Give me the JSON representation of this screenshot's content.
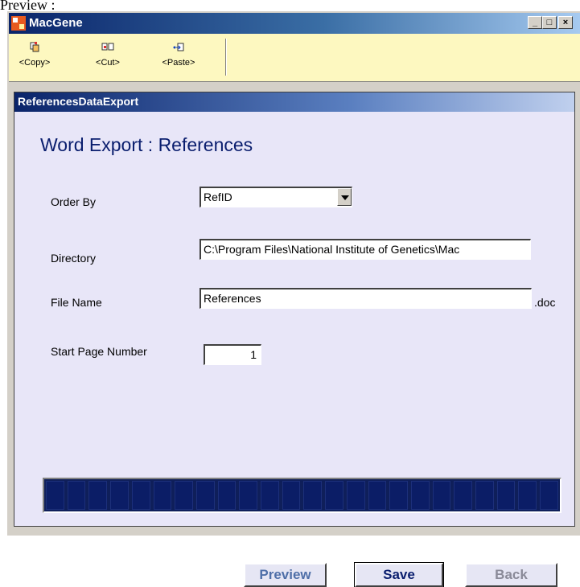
{
  "caption": "Preview :",
  "window": {
    "title": "MacGene",
    "controls": {
      "minimize": "_",
      "maximize": "□",
      "close": "×"
    }
  },
  "toolbar": {
    "copy_label": "<Copy>",
    "cut_label": "<Cut>",
    "paste_label": "<Paste>"
  },
  "panel": {
    "title": "ReferencesDataExport",
    "heading": "Word Export : References"
  },
  "form": {
    "order_by": {
      "label": "Order By",
      "value": "RefID"
    },
    "directory": {
      "label": "Directory",
      "value": "C:\\Program Files\\National Institute of Genetics\\Mac"
    },
    "file_name": {
      "label": "File Name",
      "value": "References",
      "suffix": ".doc"
    },
    "start_page": {
      "label": "Start Page Number",
      "value": "1"
    }
  },
  "progress": {
    "percent": 100,
    "color": "#0b1d66"
  },
  "buttons": {
    "preview": "Preview",
    "save": "Save",
    "back": "Back"
  },
  "colors": {
    "titlebar": "#0a246a",
    "toolbar_bg": "#fdf8c0",
    "panel_bg": "#e8e6f8",
    "heading": "#0a1e6e"
  }
}
